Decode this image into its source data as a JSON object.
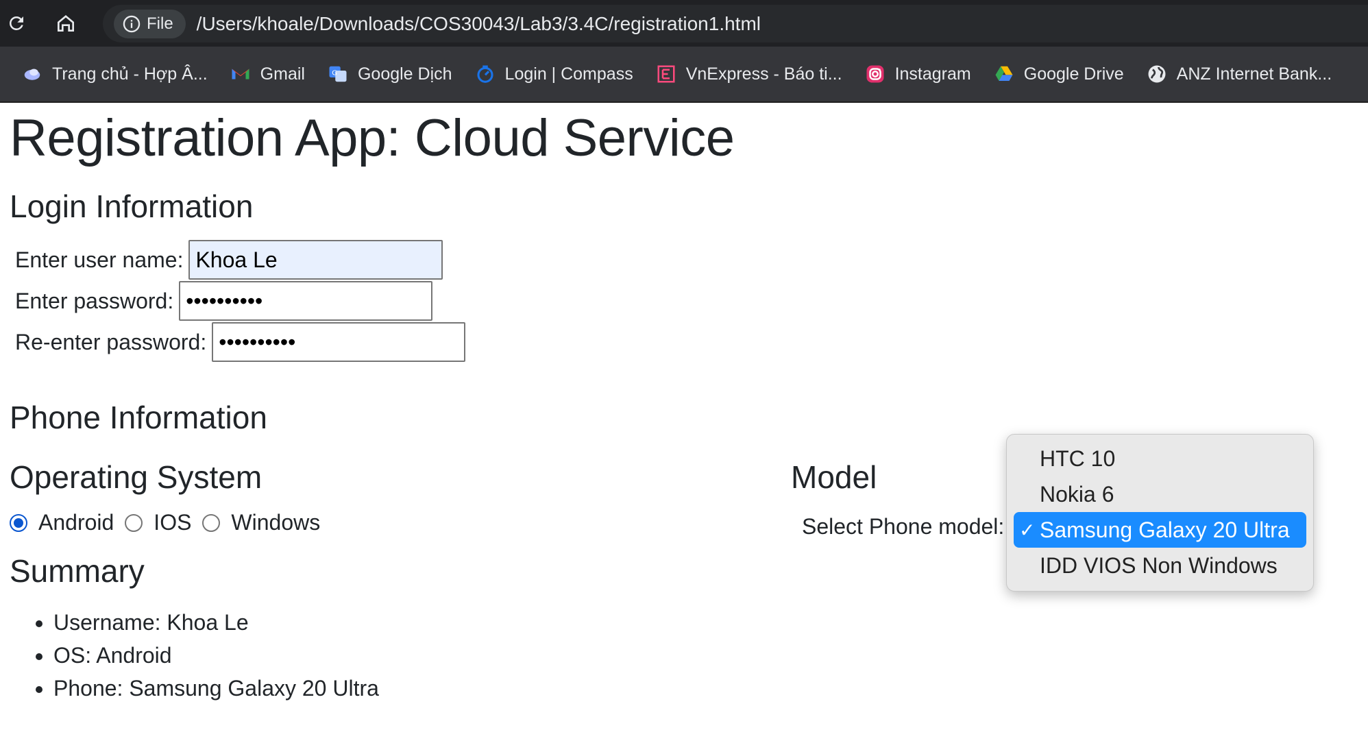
{
  "browser": {
    "site_info_label": "File",
    "url": "/Users/khoale/Downloads/COS30043/Lab3/3.4C/registration1.html",
    "bookmarks": [
      {
        "label": "Trang chủ - Hợp Â...",
        "icon": "cloud-icon",
        "color": "#8ab4f8"
      },
      {
        "label": "Gmail",
        "icon": "gmail-icon",
        "color": "#ea4335"
      },
      {
        "label": "Google Dịch",
        "icon": "translate-icon",
        "color": "#4285f4"
      },
      {
        "label": "Login | Compass",
        "icon": "compass-icon",
        "color": "#1a73e8"
      },
      {
        "label": "VnExpress - Báo ti...",
        "icon": "vnexpress-icon",
        "color": "#9f224e"
      },
      {
        "label": "Instagram",
        "icon": "instagram-icon",
        "color": "#e1306c"
      },
      {
        "label": "Google Drive",
        "icon": "drive-icon",
        "color": "#34a853"
      },
      {
        "label": "ANZ Internet Bank...",
        "icon": "globe-icon",
        "color": "#ffffff"
      }
    ]
  },
  "page": {
    "title": "Registration App: Cloud Service",
    "login": {
      "heading": "Login Information",
      "username_label": "Enter user name:",
      "username_value": "Khoa Le",
      "password_label": "Enter password:",
      "password_value": "••••••••••",
      "repassword_label": "Re-enter password:",
      "repassword_value": "••••••••••"
    },
    "phone": {
      "heading": "Phone Information",
      "os_heading": "Operating System",
      "os_options": [
        "Android",
        "IOS",
        "Windows"
      ],
      "os_selected": "Android",
      "model_heading": "Model",
      "model_label": "Select Phone model:",
      "model_options": [
        "HTC 10",
        "Nokia 6",
        "Samsung Galaxy 20 Ultra",
        "IDD VIOS Non Windows"
      ],
      "model_selected": "Samsung Galaxy 20 Ultra",
      "check_mark": "✓"
    },
    "summary": {
      "heading": "Summary",
      "items": [
        "Username: Khoa Le",
        "OS: Android",
        "Phone: Samsung Galaxy 20 Ultra"
      ]
    }
  },
  "colors": {
    "accent": "#0b57d0",
    "selection": "#1a8cff",
    "autofill": "#e8f0fe"
  }
}
